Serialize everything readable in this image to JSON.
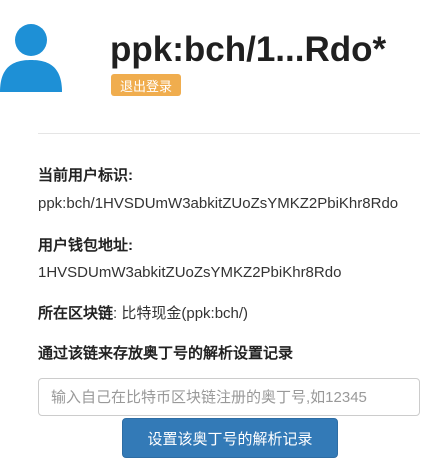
{
  "header": {
    "avatar_icon": "user-avatar-icon",
    "title": "ppk:bch/1...Rdo*",
    "logout_label": "退出登录",
    "logout_color": "#f0ad4e"
  },
  "info": {
    "user_id_label": "当前用户标识:",
    "user_id_value": "ppk:bch/1HVSDUmW3abkitZUoZsYMKZ2PbiKhr8Rdo",
    "wallet_label": "用户钱包地址:",
    "wallet_value": "1HVSDUmW3abkitZUoZsYMKZ2PbiKhr8Rdo",
    "chain_label": "所在区块链",
    "chain_value": ": 比特现金(ppk:bch/)"
  },
  "form": {
    "heading": "通过该链来存放奥丁号的解析设置记录",
    "input_placeholder": "输入自己在比特币区块链注册的奥丁号,如12345",
    "input_value": "",
    "submit_label": "设置该奥丁号的解析记录",
    "submit_color": "#337ab7"
  }
}
